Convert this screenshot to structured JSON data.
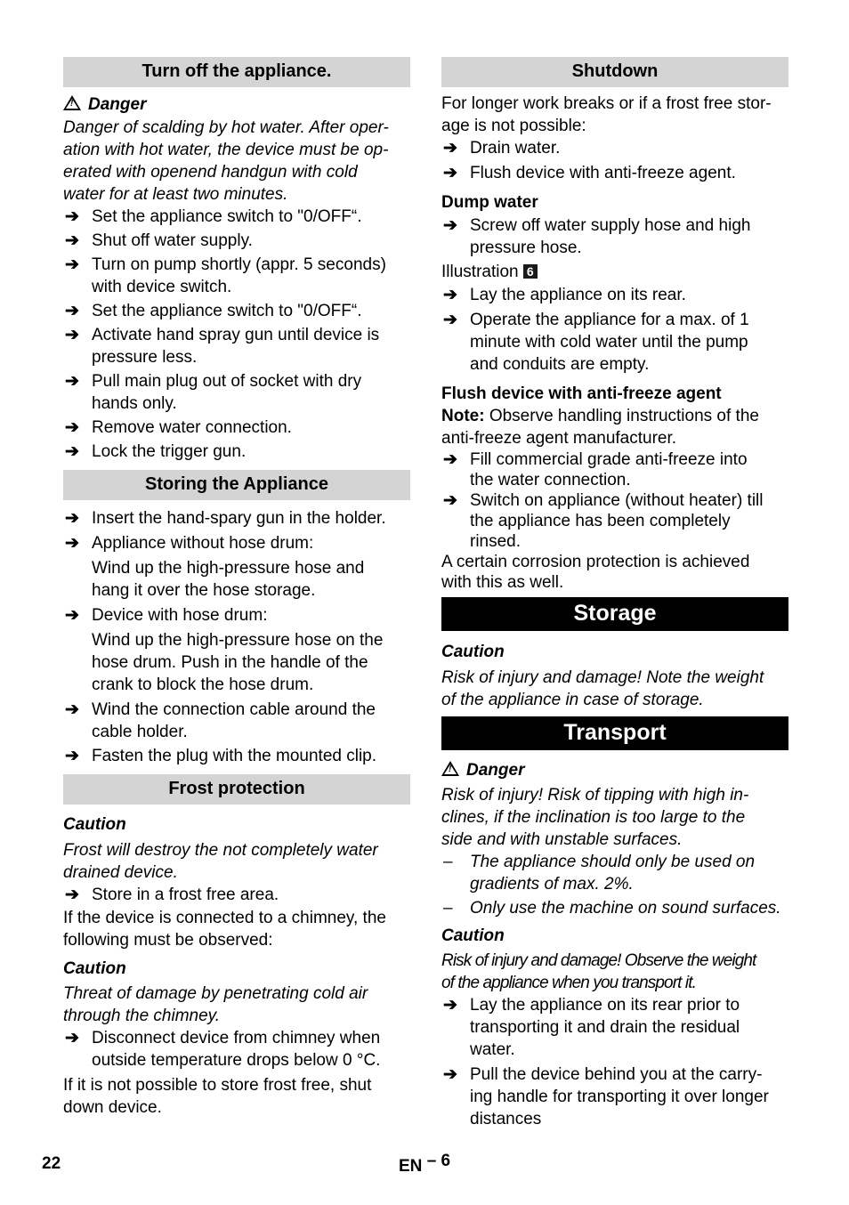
{
  "left": {
    "turn_off": {
      "heading": "Turn off the appliance.",
      "danger_label": "Danger",
      "danger_text": [
        "Danger of scalding by hot water. After oper-",
        "ation with hot water, the device must be op-",
        "erated with openend handgun with cold",
        "water for at least two minutes."
      ],
      "steps": [
        [
          "Set the appliance switch to \"0/OFF“."
        ],
        [
          "Shut off water supply."
        ],
        [
          "Turn on pump shortly (appr. 5 seconds)",
          "with device switch."
        ],
        [
          "Set the appliance switch to \"0/OFF“."
        ],
        [
          "Activate hand spray gun until device is",
          "pressure less."
        ],
        [
          "Pull main plug out of socket with dry",
          "hands only."
        ],
        [
          "Remove water connection."
        ],
        [
          "Lock the trigger gun."
        ]
      ]
    },
    "storing": {
      "heading": "Storing the Appliance",
      "step1": "Insert the hand-spary gun in the holder.",
      "step2": "Appliance without hose drum:",
      "step2_sub": [
        "Wind up the high-pressure hose and",
        "hang it over the hose storage."
      ],
      "step3": "Device with hose drum:",
      "step3_sub": [
        "Wind up the high-pressure hose on the",
        "hose drum. Push in the handle of the",
        "crank to block the hose drum."
      ],
      "step4": [
        "Wind the connection cable around the",
        "cable holder."
      ],
      "step5": "Fasten the plug with the mounted clip."
    },
    "frost": {
      "heading": "Frost protection",
      "caution1_label": "Caution",
      "caution1_text": [
        "Frost will destroy the not completely water",
        "drained device."
      ],
      "step1": "Store in a frost free area.",
      "para1": [
        "If the device is connected to a chimney, the",
        "following must be observed:"
      ],
      "caution2_label": "Caution",
      "caution2_text": [
        "Threat of damage by penetrating cold air",
        "through the chimney."
      ],
      "step2": [
        "Disconnect device from chimney when",
        "outside temperature drops below 0 °C."
      ],
      "para2": [
        "If it is not possible to store frost free, shut",
        "down device."
      ]
    }
  },
  "right": {
    "shutdown": {
      "heading": "Shutdown",
      "intro": [
        "For longer work breaks or if a frost free stor-",
        "age is not possible:"
      ],
      "steps": [
        "Drain water.",
        "Flush device with anti-freeze agent."
      ]
    },
    "dump": {
      "heading": "Dump water",
      "step1": [
        "Screw off water supply hose and high",
        "pressure hose."
      ],
      "illustration_label": "Illustration",
      "illustration_num": "6",
      "step2": "Lay the appliance on its rear.",
      "step3": [
        "Operate the appliance for a max. of 1",
        "minute with cold water until the pump",
        "and conduits are empty."
      ]
    },
    "flush": {
      "heading": "Flush device with anti-freeze agent",
      "note_label": "Note:",
      "note_text": " Observe handling instructions of the",
      "note_text2": "anti-freeze agent manufacturer.",
      "step1": [
        "Fill commercial grade anti-freeze into",
        "the water connection."
      ],
      "step2": [
        "Switch on appliance (without heater) till",
        "the appliance has been completely",
        "rinsed."
      ],
      "para": [
        "A certain corrosion protection is achieved",
        "with this as well."
      ]
    },
    "storage": {
      "heading": "Storage",
      "caution_label": "Caution",
      "caution_text": [
        "Risk of injury and damage! Note the weight",
        "of the appliance in case of storage."
      ]
    },
    "transport": {
      "heading": "Transport",
      "danger_label": "Danger",
      "danger_text": [
        "Risk of injury! Risk of tipping with high in-",
        "clines, if the inclination is too large to the",
        "side and with unstable surfaces."
      ],
      "dash1": [
        "The appliance should only be used on",
        "gradients of max. 2%."
      ],
      "dash2": "Only use the machine on sound surfaces.",
      "caution_label": "Caution",
      "caution_text": [
        "Risk of injury and damage! Observe the weight",
        "of the appliance when you transport it."
      ],
      "step1": [
        "Lay the appliance on its rear prior to",
        "transporting it and drain the residual",
        "water."
      ],
      "step2": [
        "Pull the device behind you at the carry-",
        "ing handle for transporting it over longer",
        "distances"
      ]
    }
  },
  "footer": {
    "page_number": "22",
    "lang_label": "EN",
    "section_number": "– 6"
  },
  "icons": {
    "bullet": "arrow-right-icon",
    "warning": "warning-triangle-icon"
  }
}
